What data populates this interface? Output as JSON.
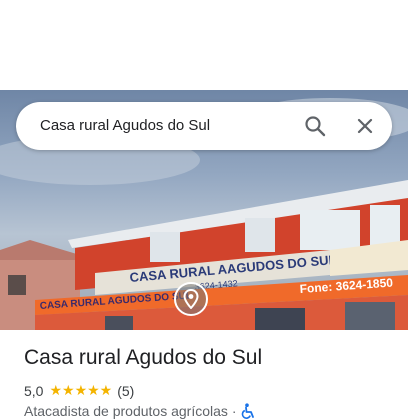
{
  "search": {
    "query": "Casa rural Agudos do Sul"
  },
  "place": {
    "name": "Casa rural Agudos do Sul",
    "rating": "5,0",
    "stars": "★★★★★",
    "reviews": "(5)",
    "category": "Atacadista de produtos agrícolas",
    "separator": "·"
  },
  "photo": {
    "sign_main": "CASA RURAL AAGUDOS DO SUL",
    "sign_phone_top": "3624-1432",
    "sign_lower": "CASA RURAL AGUDOS DO SUL",
    "sign_fone": "Fone: 3624-1850"
  },
  "icons": {
    "search": "search-icon",
    "close": "close-icon",
    "pin": "location-pin-icon",
    "accessible": "wheelchair-icon"
  },
  "colors": {
    "star": "#f4b400",
    "accessible": "#1a73e8",
    "building": "#d4472f"
  }
}
